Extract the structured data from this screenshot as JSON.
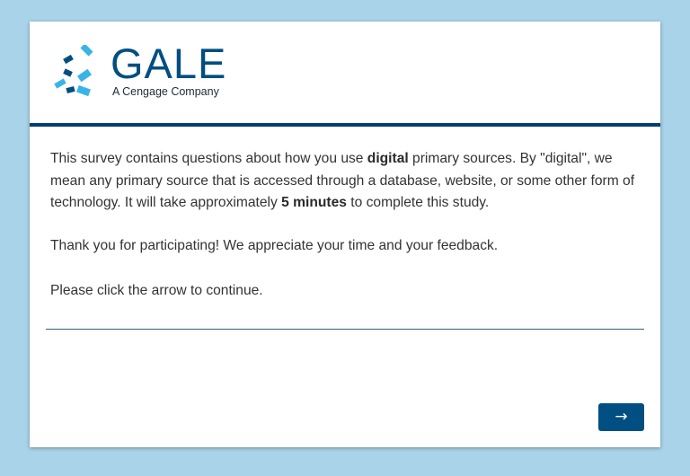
{
  "logo": {
    "wordmark": "GALE",
    "tagline": "A Cengage Company",
    "colors": {
      "dark": "#004e82",
      "light": "#39b4e6"
    }
  },
  "intro": {
    "p1_before": "This survey contains questions about how you use ",
    "p1_bold1": "digital",
    "p1_mid": " primary sources. By \"digital\", we mean any primary source that is accessed through a database, website, or some other form of technology. It will take approximately ",
    "p1_bold2": "5 minutes",
    "p1_after": " to complete this study.",
    "p2": "Thank you for participating! We appreciate your time and your feedback.",
    "p3": "Please click the arrow to continue."
  },
  "navigation": {
    "next_label": "→",
    "next_icon": "right-arrow-icon"
  },
  "colors": {
    "background": "#a9d3e8",
    "card": "#ffffff",
    "header_rule": "#003f74",
    "button": "#004e82"
  }
}
